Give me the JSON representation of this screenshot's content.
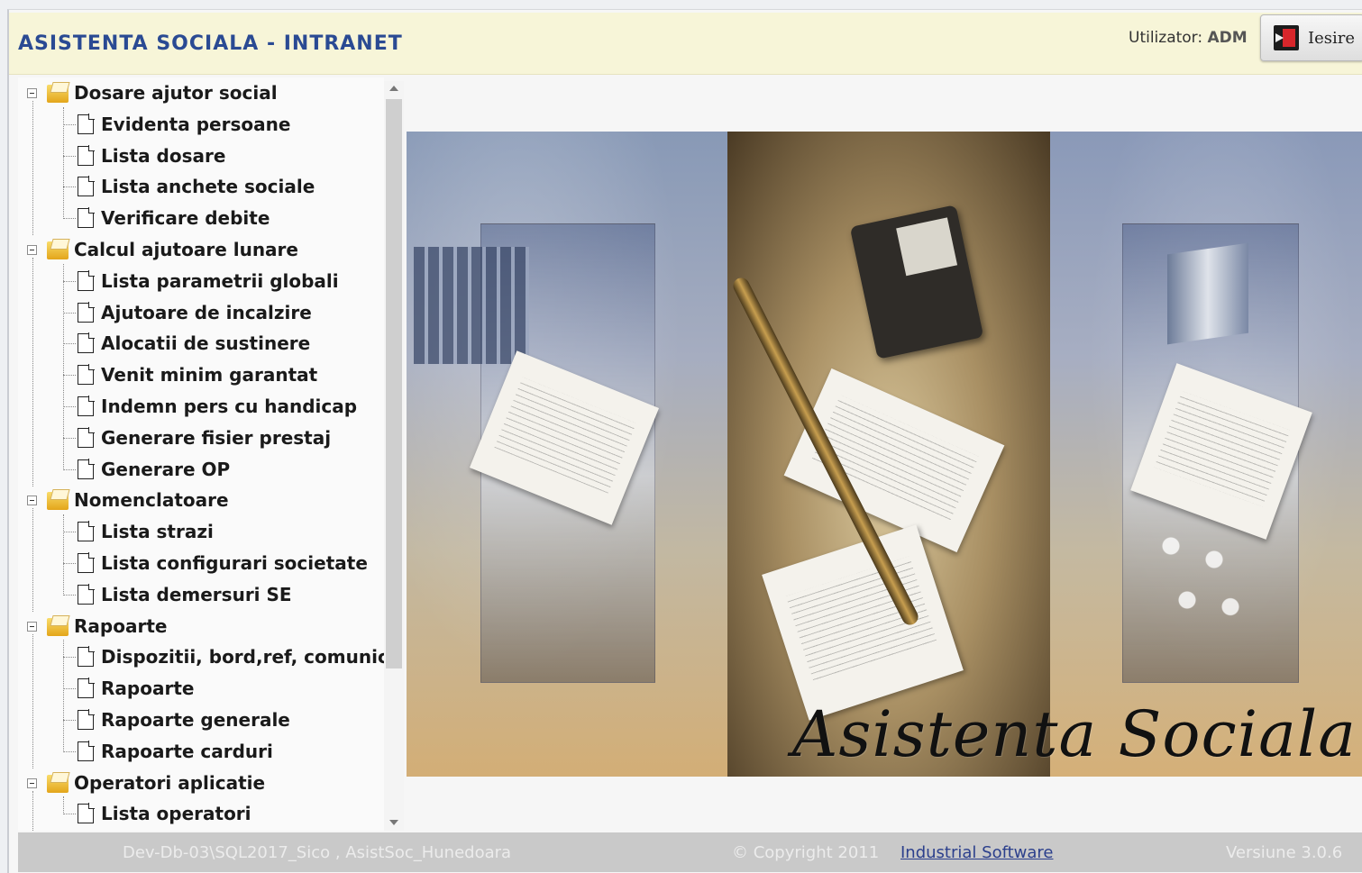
{
  "header": {
    "title": "ASISTENTA SOCIALA - INTRANET",
    "user_label": "Utilizator:",
    "user_name": "ADM",
    "logout_label": "Iesire"
  },
  "menu": [
    {
      "label": "Dosare ajutor social",
      "items": [
        "Evidenta persoane",
        "Lista dosare",
        "Lista anchete sociale",
        "Verificare debite"
      ]
    },
    {
      "label": "Calcul ajutoare lunare",
      "items": [
        "Lista parametrii globali",
        "Ajutoare de incalzire",
        "Alocatii de sustinere",
        "Venit minim garantat",
        "Indemn pers cu handicap",
        "Generare fisier prestaj",
        "Generare OP"
      ]
    },
    {
      "label": "Nomenclatoare",
      "items": [
        "Lista strazi",
        "Lista configurari societate",
        "Lista demersuri SE"
      ]
    },
    {
      "label": "Rapoarte",
      "items": [
        "Dispozitii, bord,ref, comunic",
        "Rapoarte",
        "Rapoarte generale",
        "Rapoarte carduri"
      ]
    },
    {
      "label": "Operatori aplicatie",
      "items": [
        "Lista operatori"
      ]
    }
  ],
  "banner": {
    "caption": "Asistenta Sociala"
  },
  "footer": {
    "db": "Dev-Db-03\\SQL2017_Sico , AsistSoc_Hunedoara",
    "copyright": "© Copyright 2011",
    "company": "Industrial Software",
    "version": "Versiune 3.0.6"
  },
  "colors": {
    "header_bg": "#f7f5d8",
    "title": "#2a4a93",
    "footer_bg": "#c9c9c9",
    "link": "#2b3f8c"
  }
}
